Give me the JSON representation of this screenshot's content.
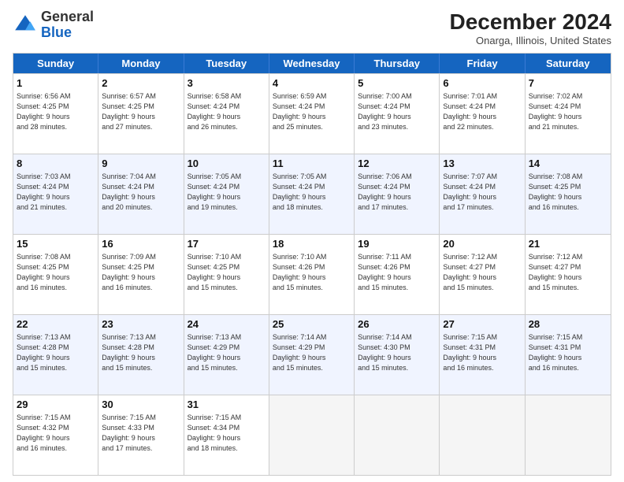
{
  "logo": {
    "line1": "General",
    "line2": "Blue"
  },
  "title": "December 2024",
  "location": "Onarga, Illinois, United States",
  "days_of_week": [
    "Sunday",
    "Monday",
    "Tuesday",
    "Wednesday",
    "Thursday",
    "Friday",
    "Saturday"
  ],
  "weeks": [
    [
      {
        "day": 1,
        "info": "Sunrise: 6:56 AM\nSunset: 4:25 PM\nDaylight: 9 hours\nand 28 minutes."
      },
      {
        "day": 2,
        "info": "Sunrise: 6:57 AM\nSunset: 4:25 PM\nDaylight: 9 hours\nand 27 minutes."
      },
      {
        "day": 3,
        "info": "Sunrise: 6:58 AM\nSunset: 4:24 PM\nDaylight: 9 hours\nand 26 minutes."
      },
      {
        "day": 4,
        "info": "Sunrise: 6:59 AM\nSunset: 4:24 PM\nDaylight: 9 hours\nand 25 minutes."
      },
      {
        "day": 5,
        "info": "Sunrise: 7:00 AM\nSunset: 4:24 PM\nDaylight: 9 hours\nand 23 minutes."
      },
      {
        "day": 6,
        "info": "Sunrise: 7:01 AM\nSunset: 4:24 PM\nDaylight: 9 hours\nand 22 minutes."
      },
      {
        "day": 7,
        "info": "Sunrise: 7:02 AM\nSunset: 4:24 PM\nDaylight: 9 hours\nand 21 minutes."
      }
    ],
    [
      {
        "day": 8,
        "info": "Sunrise: 7:03 AM\nSunset: 4:24 PM\nDaylight: 9 hours\nand 21 minutes."
      },
      {
        "day": 9,
        "info": "Sunrise: 7:04 AM\nSunset: 4:24 PM\nDaylight: 9 hours\nand 20 minutes."
      },
      {
        "day": 10,
        "info": "Sunrise: 7:05 AM\nSunset: 4:24 PM\nDaylight: 9 hours\nand 19 minutes."
      },
      {
        "day": 11,
        "info": "Sunrise: 7:05 AM\nSunset: 4:24 PM\nDaylight: 9 hours\nand 18 minutes."
      },
      {
        "day": 12,
        "info": "Sunrise: 7:06 AM\nSunset: 4:24 PM\nDaylight: 9 hours\nand 17 minutes."
      },
      {
        "day": 13,
        "info": "Sunrise: 7:07 AM\nSunset: 4:24 PM\nDaylight: 9 hours\nand 17 minutes."
      },
      {
        "day": 14,
        "info": "Sunrise: 7:08 AM\nSunset: 4:25 PM\nDaylight: 9 hours\nand 16 minutes."
      }
    ],
    [
      {
        "day": 15,
        "info": "Sunrise: 7:08 AM\nSunset: 4:25 PM\nDaylight: 9 hours\nand 16 minutes."
      },
      {
        "day": 16,
        "info": "Sunrise: 7:09 AM\nSunset: 4:25 PM\nDaylight: 9 hours\nand 16 minutes."
      },
      {
        "day": 17,
        "info": "Sunrise: 7:10 AM\nSunset: 4:25 PM\nDaylight: 9 hours\nand 15 minutes."
      },
      {
        "day": 18,
        "info": "Sunrise: 7:10 AM\nSunset: 4:26 PM\nDaylight: 9 hours\nand 15 minutes."
      },
      {
        "day": 19,
        "info": "Sunrise: 7:11 AM\nSunset: 4:26 PM\nDaylight: 9 hours\nand 15 minutes."
      },
      {
        "day": 20,
        "info": "Sunrise: 7:12 AM\nSunset: 4:27 PM\nDaylight: 9 hours\nand 15 minutes."
      },
      {
        "day": 21,
        "info": "Sunrise: 7:12 AM\nSunset: 4:27 PM\nDaylight: 9 hours\nand 15 minutes."
      }
    ],
    [
      {
        "day": 22,
        "info": "Sunrise: 7:13 AM\nSunset: 4:28 PM\nDaylight: 9 hours\nand 15 minutes."
      },
      {
        "day": 23,
        "info": "Sunrise: 7:13 AM\nSunset: 4:28 PM\nDaylight: 9 hours\nand 15 minutes."
      },
      {
        "day": 24,
        "info": "Sunrise: 7:13 AM\nSunset: 4:29 PM\nDaylight: 9 hours\nand 15 minutes."
      },
      {
        "day": 25,
        "info": "Sunrise: 7:14 AM\nSunset: 4:29 PM\nDaylight: 9 hours\nand 15 minutes."
      },
      {
        "day": 26,
        "info": "Sunrise: 7:14 AM\nSunset: 4:30 PM\nDaylight: 9 hours\nand 15 minutes."
      },
      {
        "day": 27,
        "info": "Sunrise: 7:15 AM\nSunset: 4:31 PM\nDaylight: 9 hours\nand 16 minutes."
      },
      {
        "day": 28,
        "info": "Sunrise: 7:15 AM\nSunset: 4:31 PM\nDaylight: 9 hours\nand 16 minutes."
      }
    ],
    [
      {
        "day": 29,
        "info": "Sunrise: 7:15 AM\nSunset: 4:32 PM\nDaylight: 9 hours\nand 16 minutes."
      },
      {
        "day": 30,
        "info": "Sunrise: 7:15 AM\nSunset: 4:33 PM\nDaylight: 9 hours\nand 17 minutes."
      },
      {
        "day": 31,
        "info": "Sunrise: 7:15 AM\nSunset: 4:34 PM\nDaylight: 9 hours\nand 18 minutes."
      },
      null,
      null,
      null,
      null
    ]
  ]
}
